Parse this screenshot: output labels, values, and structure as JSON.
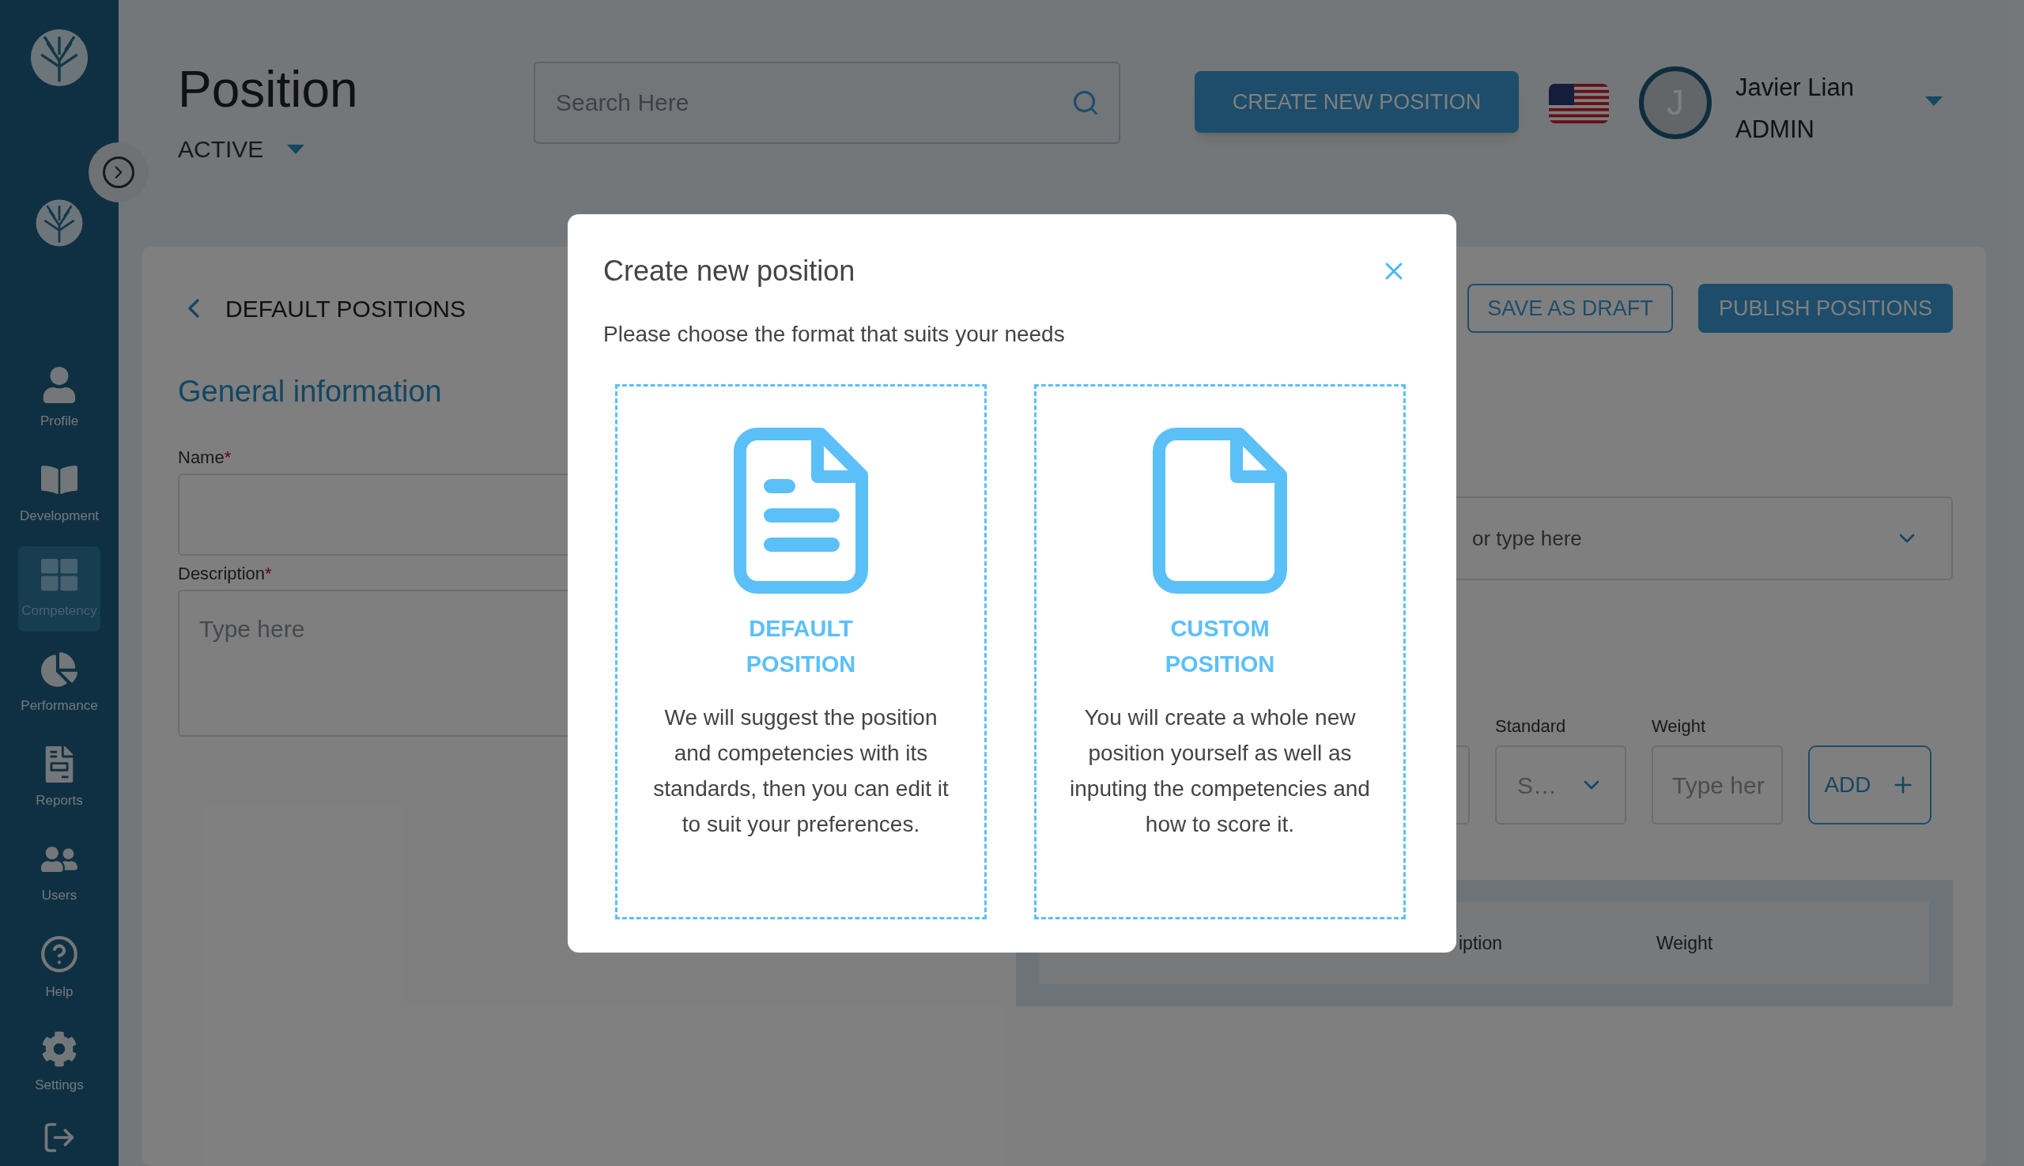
{
  "sidebar": {
    "items": [
      {
        "label": "Profile",
        "selected": false
      },
      {
        "label": "Development",
        "selected": false
      },
      {
        "label": "Competency",
        "selected": true
      },
      {
        "label": "Performance",
        "selected": false
      },
      {
        "label": "Reports",
        "selected": false
      },
      {
        "label": "Users",
        "selected": false
      },
      {
        "label": "Help",
        "selected": false
      },
      {
        "label": "Settings",
        "selected": false
      }
    ]
  },
  "header": {
    "title": "Position",
    "status_filter": "ACTIVE",
    "search": {
      "placeholder": "Search Here"
    },
    "create_button": "CREATE NEW POSITION",
    "user": {
      "initial": "J",
      "name": "Javier Lian",
      "role": "ADMIN"
    }
  },
  "form": {
    "back_label": "DEFAULT POSITIONS",
    "save_draft_button": "SAVE AS DRAFT",
    "publish_button": "PUBLISH POSITIONS",
    "section_title": "General information",
    "name_field": {
      "label": "Name",
      "marker": "*"
    },
    "description_field": {
      "label": "Description",
      "marker": "*",
      "placeholder": "Type here"
    },
    "select_field": {
      "placeholder": "or type here"
    },
    "standard": {
      "label": "Standard",
      "value": "S…"
    },
    "weight": {
      "label": "Weight",
      "placeholder": "Type her"
    },
    "add_button": "ADD",
    "table": {
      "columns": [
        "iption",
        "Weight"
      ]
    }
  },
  "modal": {
    "title": "Create new position",
    "subtitle": "Please choose the format that suits your needs",
    "options": [
      {
        "kind": "lines",
        "title": "DEFAULT POSITION",
        "description": "We will suggest the position and competencies with its standards, then you can edit it to suit your preferences."
      },
      {
        "kind": "blank",
        "title": "CUSTOM POSITION",
        "description": "You will create a whole new position yourself as well as inputing the competencies and how to score it."
      }
    ]
  }
}
